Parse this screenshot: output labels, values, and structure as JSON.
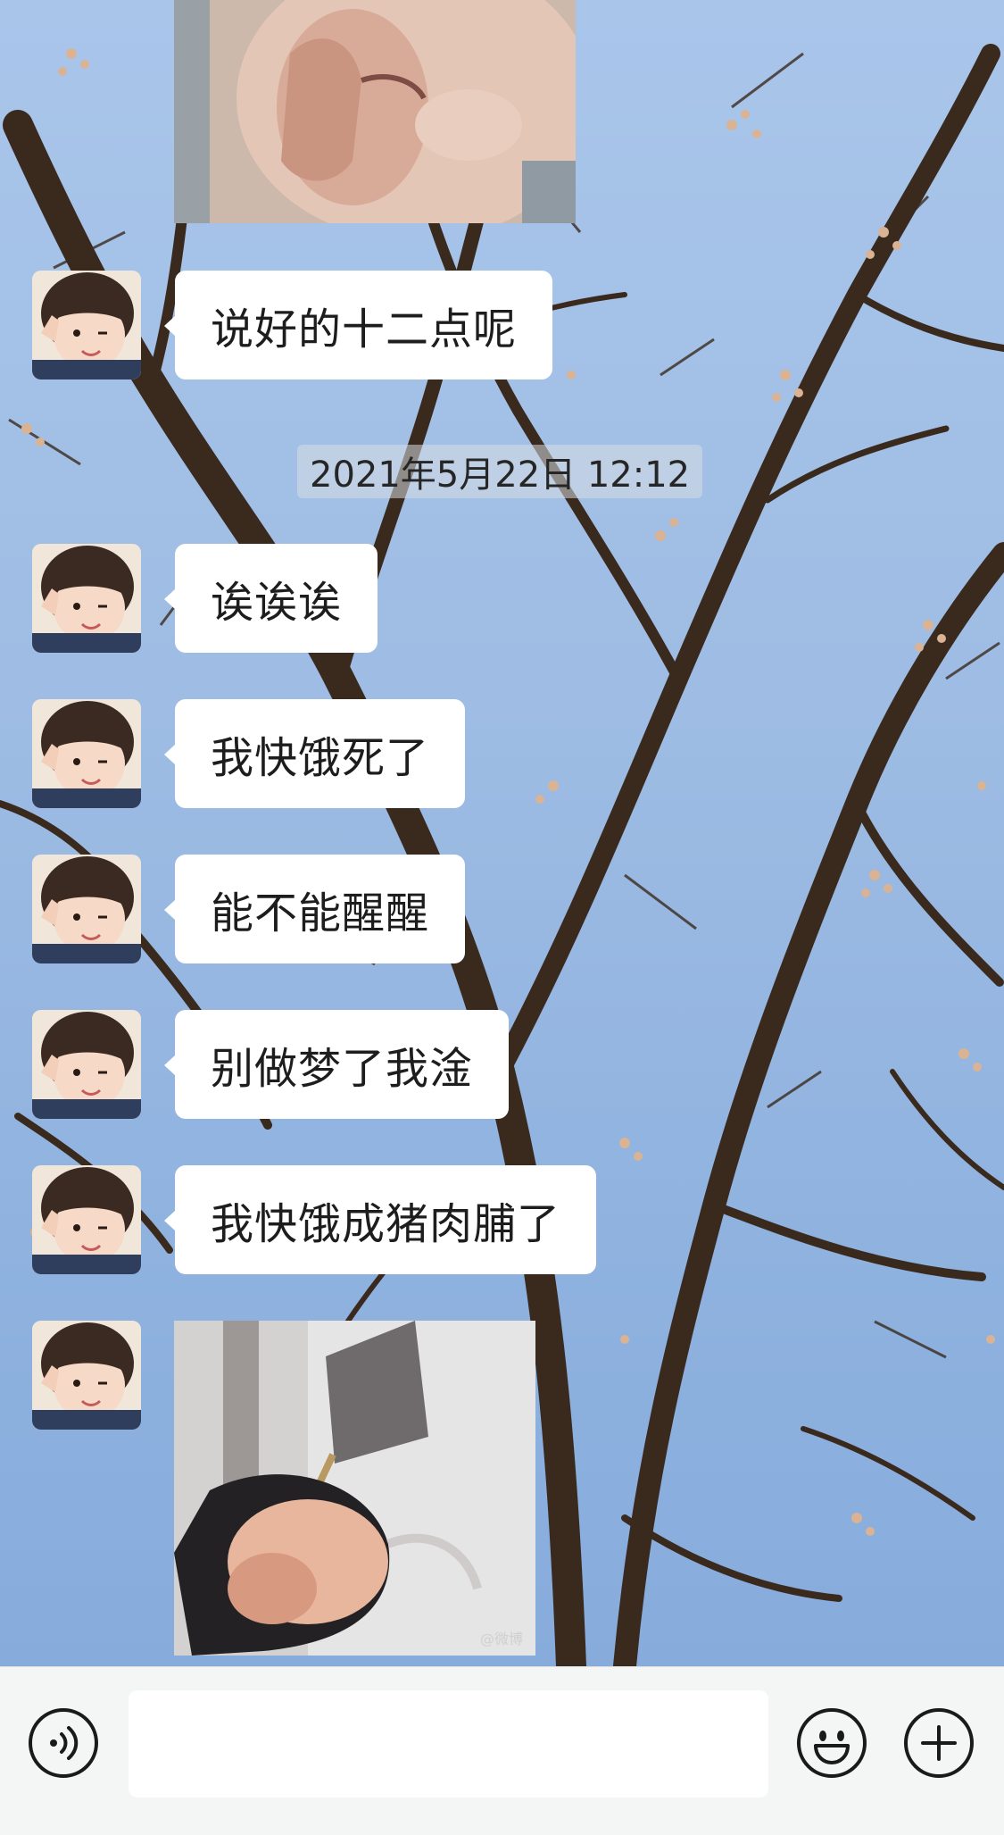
{
  "chat": {
    "timestamp": "2021年5月22日 12:12",
    "messages": [
      {
        "type": "text",
        "text": "说好的十二点呢"
      },
      {
        "type": "text",
        "text": "诶诶诶"
      },
      {
        "type": "text",
        "text": "我快饿死了"
      },
      {
        "type": "text",
        "text": "能不能醒醒"
      },
      {
        "type": "text",
        "text": "别做梦了我淦"
      },
      {
        "type": "text",
        "text": "我快饿成猪肉脯了"
      }
    ],
    "stickers": [
      {
        "icon": "child-nose-picking-sticker"
      },
      {
        "icon": "hand-holding-cleaver-sticker",
        "watermark": "@微博"
      }
    ]
  },
  "input_bar": {
    "voice_icon": "voice-icon",
    "input_value": "",
    "emoji_icon": "emoji-icon",
    "plus_icon": "plus-icon"
  },
  "colors": {
    "bubble": "#ffffff",
    "input_bar": "#f4f5f5",
    "sky": "#9dbbe2"
  }
}
